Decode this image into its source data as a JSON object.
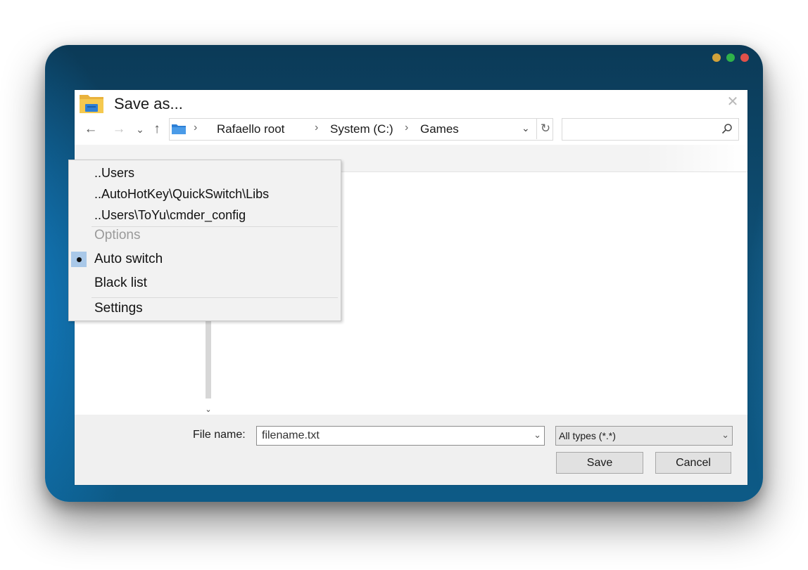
{
  "dialog": {
    "title": "Save as...",
    "close_glyph": "✕",
    "nav": {
      "back": "←",
      "forward": "→",
      "recent": "⌄",
      "up": "↑"
    },
    "address": {
      "separator": "›",
      "crumbs": [
        "Rafaello root",
        "System (C:)",
        "Games"
      ],
      "dropdown_glyph": "⌄",
      "refresh_glyph": "↻"
    },
    "search": {
      "placeholder": ""
    },
    "file_name_label": "File name:",
    "file_name_value": "filename.txt",
    "file_type_value": "All types (*.*)",
    "dropdown_glyph": "⌄",
    "scroll_down_glyph": "⌄",
    "save_label": "Save",
    "cancel_label": "Cancel"
  },
  "context_menu": {
    "recent_paths": [
      "..Users",
      "..AutoHotKey\\QuickSwitch\\Libs",
      "..Users\\ToYu\\cmder_config"
    ],
    "options_header": "Options",
    "auto_switch": "Auto switch",
    "auto_switch_checked": true,
    "black_list": "Black list",
    "settings": "Settings"
  },
  "colors": {
    "desktop_dark": "#0b3a57",
    "desktop_accent": "#1a8fd6",
    "folder_yellow": "#f2c14a",
    "folder_blue": "#2d7fd6",
    "menu_highlight": "#a9c8e8",
    "traffic_yellow": "#d2a23a",
    "traffic_green": "#2fb24a",
    "traffic_red": "#e0514a"
  },
  "icons": [
    "folder-icon",
    "back-arrow-icon",
    "forward-arrow-icon",
    "chevron-down-icon",
    "up-arrow-icon",
    "refresh-icon",
    "search-icon",
    "close-icon",
    "radio-dot-icon"
  ]
}
